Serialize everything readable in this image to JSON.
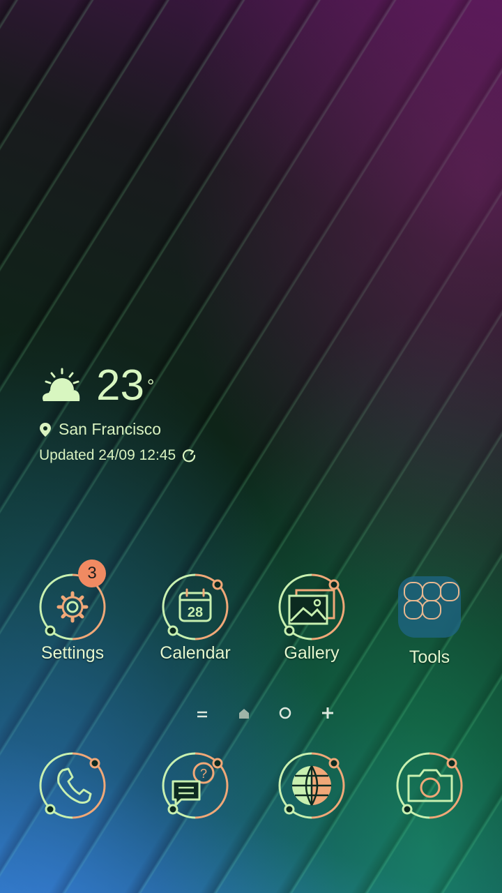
{
  "weather": {
    "temperature": "23",
    "degree_symbol": "°",
    "location": "San Francisco",
    "updated": "Updated 24/09 12:45",
    "icon": "partly-sunny-icon"
  },
  "apps": [
    {
      "label": "Settings",
      "icon": "gear-icon",
      "badge": "3"
    },
    {
      "label": "Calendar",
      "icon": "calendar-icon",
      "date": "28"
    },
    {
      "label": "Gallery",
      "icon": "gallery-icon"
    },
    {
      "label": "Tools",
      "icon": "folder-icon"
    }
  ],
  "page_indicator": [
    "menu-icon",
    "home-icon",
    "circle-icon",
    "plus-icon"
  ],
  "dock": [
    {
      "icon": "phone-icon"
    },
    {
      "icon": "messages-icon"
    },
    {
      "icon": "internet-icon"
    },
    {
      "icon": "camera-icon"
    }
  ],
  "colors": {
    "text": "#d9f2c0",
    "badge": "#f08a62",
    "icon_green": "#c8f0b0",
    "icon_orange": "#f0a878"
  }
}
